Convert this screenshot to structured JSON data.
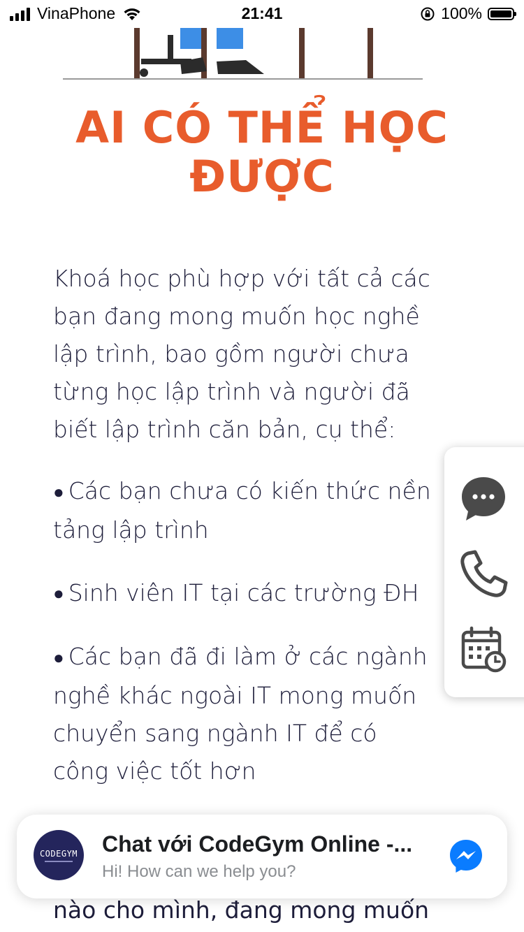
{
  "status_bar": {
    "carrier": "VinaPhone",
    "time": "21:41",
    "battery": "100%"
  },
  "section": {
    "title": "AI CÓ THỂ HỌC\nĐƯỢC",
    "intro": "Khoá học phù hợp với tất cả các\nbạn đang mong muốn học nghề\nlập trình, bao gồm người chưa\ntừng học lập trình và người đã\nbiết lập trình căn bản, cụ thể:",
    "bullets": [
      "Các bạn chưa có kiến thức nền\ntảng lập trình",
      "Sinh viên IT tại các trường ĐH",
      "Các bạn đã đi làm ở các ngành\nnghề khác ngoài IT mong muốn\nchuyển sang ngành IT để có\ncông việc tốt hơn"
    ],
    "bullet_symbol": "●",
    "trailing_text": "nào cho mình, đang mong muốn"
  },
  "contact_widget": {
    "icons": [
      "chat-bubble-icon",
      "phone-icon",
      "calendar-clock-icon"
    ]
  },
  "chat_bar": {
    "avatar_text": "CODEGYM",
    "title": "Chat với CodeGym Online -...",
    "subtitle": "Hi! How can we help you?"
  },
  "colors": {
    "title": "#e85c2c",
    "text": "#1d1d3a",
    "messenger": "#0a7cff",
    "avatar_bg": "#24255c",
    "widget_icon": "#4a4a4a"
  }
}
